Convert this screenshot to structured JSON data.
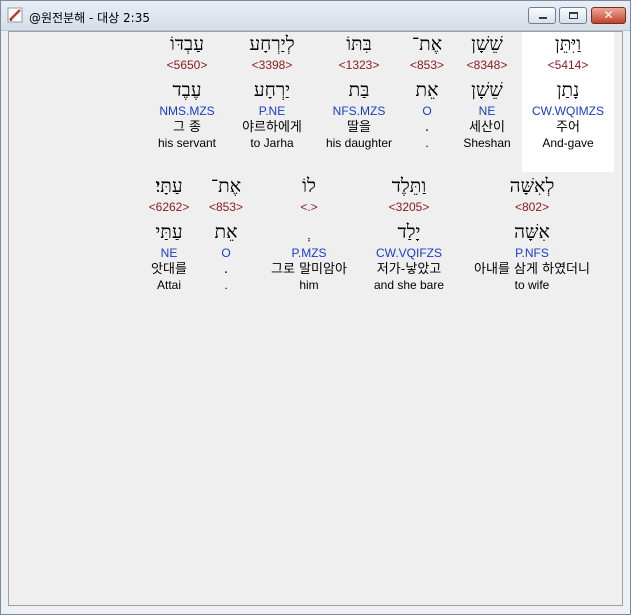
{
  "window": {
    "title": "@원전분해 - 대상 2:35",
    "icons": {
      "app": "edit-pencil-icon",
      "minimize": "minimize-icon",
      "maximize": "maximize-icon",
      "close": "close-icon"
    },
    "close_glyph": "✕"
  },
  "rows": [
    {
      "words": [
        {
          "hebrew": "וַיִּתֵּן",
          "strong": "<5414>",
          "lemma": "נָתַן",
          "morph": "CW.WQIMZS",
          "korean": "주어",
          "english": "And-gave",
          "highlight": true
        },
        {
          "hebrew": "שֵׁשָׁן",
          "strong": "<8348>",
          "lemma": "שֵׁשָׁן",
          "morph": "NE",
          "korean": "세산이",
          "english": "Sheshan"
        },
        {
          "hebrew": "אֶת־",
          "strong": "<853>",
          "lemma": "אֵת",
          "morph": "O",
          "korean": ".",
          "english": "."
        },
        {
          "hebrew": "בִּתּוֹ",
          "strong": "<1323>",
          "lemma": "בַּת",
          "morph": "NFS.MZS",
          "korean": "딸을",
          "english": "his daughter"
        },
        {
          "hebrew": "לְיַרְחָע",
          "strong": "<3398>",
          "lemma": "יַרְחָע",
          "morph": "P.NE",
          "korean": "야르하에게",
          "english": "to Jarha"
        },
        {
          "hebrew": "עַבְדּוֹ",
          "strong": "<5650>",
          "lemma": "עֶבֶד",
          "morph": "NMS.MZS",
          "korean": "그 종",
          "english": "his servant"
        }
      ]
    },
    {
      "words": [
        {
          "hebrew": "לְאִשָּׁה",
          "strong": "<802>",
          "lemma": "אִשָּׁה",
          "morph": "P.NFS",
          "korean": "아내를 삼게 하였더니",
          "english": "to wife"
        },
        {
          "hebrew": "וַתֵּלֶד",
          "strong": "<3205>",
          "lemma": "יָלַד",
          "morph": "CW.VQIFZS",
          "korean": "저가-낳았고",
          "english": "and she bare"
        },
        {
          "hebrew": "לוֹ",
          "strong": "<.>",
          "lemma": "ְ",
          "morph": "P.MZS",
          "korean": "그로 말미암아",
          "english": "him"
        },
        {
          "hebrew": "אֶת־",
          "strong": "<853>",
          "lemma": "אֵת",
          "morph": "O",
          "korean": ".",
          "english": "."
        },
        {
          "hebrew": "עַתָּי׃",
          "strong": "<6262>",
          "lemma": "עַתַּי",
          "morph": "NE",
          "korean": "앗대를",
          "english": "Attai"
        }
      ]
    }
  ]
}
